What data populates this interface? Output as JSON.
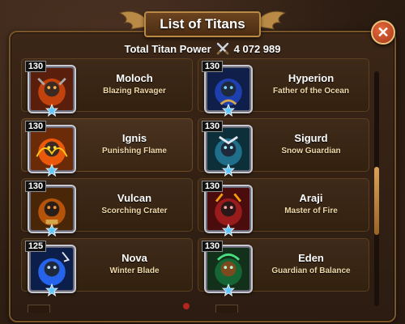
{
  "header": {
    "title": "List of Titans",
    "close_icon": "close-icon"
  },
  "summary": {
    "label": "Total Titan Power",
    "value": "4 072 989",
    "icon": "crossed-swords-icon"
  },
  "titans": [
    {
      "level": "130",
      "name": "Moloch",
      "subtitle": "Blazing Ravager",
      "element_color": "#c2410c",
      "stars": 1
    },
    {
      "level": "130",
      "name": "Hyperion",
      "subtitle": "Father of the Ocean",
      "element_color": "#1e40af",
      "stars": 1
    },
    {
      "level": "130",
      "name": "Ignis",
      "subtitle": "Punishing Flame",
      "element_color": "#ea580c",
      "stars": 1
    },
    {
      "level": "130",
      "name": "Sigurd",
      "subtitle": "Snow Guardian",
      "element_color": "#1f6f8b",
      "stars": 1
    },
    {
      "level": "130",
      "name": "Vulcan",
      "subtitle": "Scorching Crater",
      "element_color": "#b45309",
      "stars": 1
    },
    {
      "level": "130",
      "name": "Araji",
      "subtitle": "Master of Fire",
      "element_color": "#991b1b",
      "stars": 1
    },
    {
      "level": "125",
      "name": "Nova",
      "subtitle": "Winter Blade",
      "element_color": "#2563eb",
      "stars": 1
    },
    {
      "level": "130",
      "name": "Eden",
      "subtitle": "Guardian of Balance",
      "element_color": "#166534",
      "stars": 1
    }
  ],
  "colors": {
    "panel": "#3b2617",
    "border_gold": "#b88a45",
    "subtitle_text": "#f0d8a8",
    "star": "#5fc8ff"
  }
}
